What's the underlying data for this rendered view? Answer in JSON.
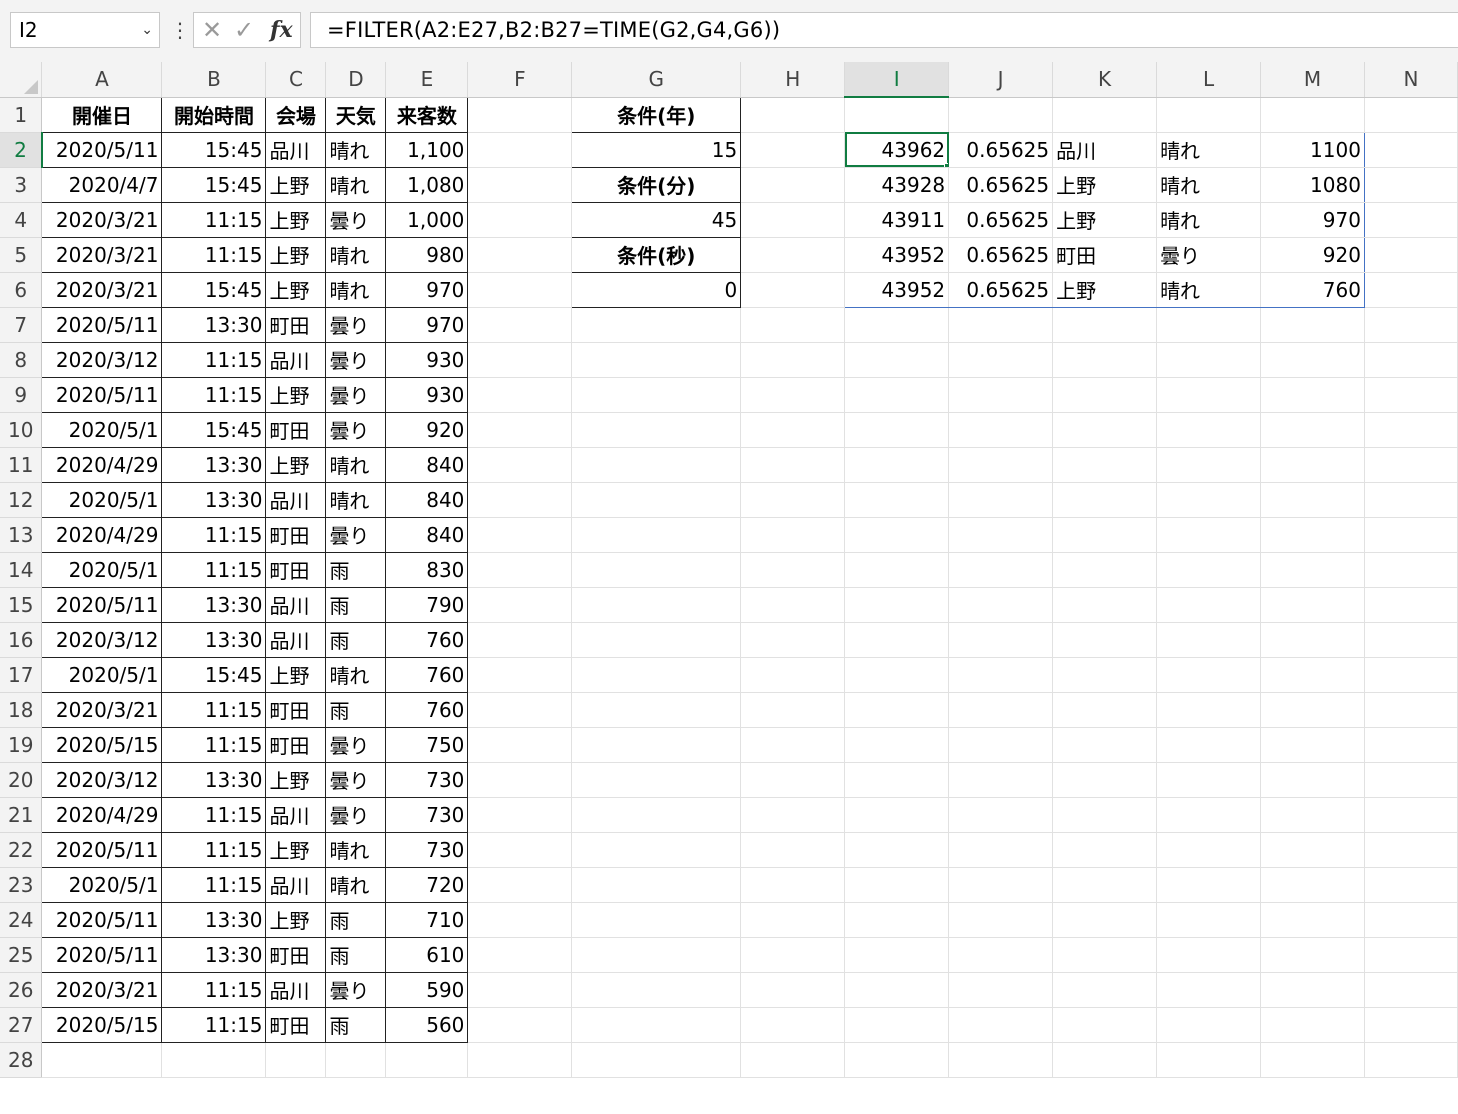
{
  "formula_bar": {
    "name_box": "I2",
    "name_box_icon": "chevron-down-icon",
    "cancel_icon": "✕",
    "enter_icon": "✓",
    "fx_label": "fx",
    "formula": "=FILTER(A2:E27,B2:B27=TIME(G2,G4,G6))"
  },
  "columns": [
    "A",
    "B",
    "C",
    "D",
    "E",
    "F",
    "G",
    "H",
    "I",
    "J",
    "K",
    "L",
    "M",
    "N"
  ],
  "selected_column": "I",
  "selected_row": "2",
  "row_numbers": [
    "1",
    "2",
    "3",
    "4",
    "5",
    "6",
    "7",
    "8",
    "9",
    "10",
    "11",
    "12",
    "13",
    "14",
    "15",
    "16",
    "17",
    "18",
    "19",
    "20",
    "21",
    "22",
    "23",
    "24",
    "25",
    "26",
    "27",
    "28"
  ],
  "headers": [
    "開催日",
    "開始時間",
    "会場",
    "天気",
    "来客数"
  ],
  "table_rows": [
    [
      "2020/5/11",
      "15:45",
      "品川",
      "晴れ",
      "1,100"
    ],
    [
      "2020/4/7",
      "15:45",
      "上野",
      "晴れ",
      "1,080"
    ],
    [
      "2020/3/21",
      "11:15",
      "上野",
      "曇り",
      "1,000"
    ],
    [
      "2020/3/21",
      "11:15",
      "上野",
      "晴れ",
      "980"
    ],
    [
      "2020/3/21",
      "15:45",
      "上野",
      "晴れ",
      "970"
    ],
    [
      "2020/5/11",
      "13:30",
      "町田",
      "曇り",
      "970"
    ],
    [
      "2020/3/12",
      "11:15",
      "品川",
      "曇り",
      "930"
    ],
    [
      "2020/5/11",
      "11:15",
      "上野",
      "曇り",
      "930"
    ],
    [
      "2020/5/1",
      "15:45",
      "町田",
      "曇り",
      "920"
    ],
    [
      "2020/4/29",
      "13:30",
      "上野",
      "晴れ",
      "840"
    ],
    [
      "2020/5/1",
      "13:30",
      "品川",
      "晴れ",
      "840"
    ],
    [
      "2020/4/29",
      "11:15",
      "町田",
      "曇り",
      "840"
    ],
    [
      "2020/5/1",
      "11:15",
      "町田",
      "雨",
      "830"
    ],
    [
      "2020/5/11",
      "13:30",
      "品川",
      "雨",
      "790"
    ],
    [
      "2020/3/12",
      "13:30",
      "品川",
      "雨",
      "760"
    ],
    [
      "2020/5/1",
      "15:45",
      "上野",
      "晴れ",
      "760"
    ],
    [
      "2020/3/21",
      "11:15",
      "町田",
      "雨",
      "760"
    ],
    [
      "2020/5/15",
      "11:15",
      "町田",
      "曇り",
      "750"
    ],
    [
      "2020/3/12",
      "13:30",
      "上野",
      "曇り",
      "730"
    ],
    [
      "2020/4/29",
      "11:15",
      "品川",
      "曇り",
      "730"
    ],
    [
      "2020/5/11",
      "11:15",
      "上野",
      "晴れ",
      "730"
    ],
    [
      "2020/5/1",
      "11:15",
      "品川",
      "晴れ",
      "720"
    ],
    [
      "2020/5/11",
      "13:30",
      "上野",
      "雨",
      "710"
    ],
    [
      "2020/5/11",
      "13:30",
      "町田",
      "雨",
      "610"
    ],
    [
      "2020/3/21",
      "11:15",
      "品川",
      "曇り",
      "590"
    ],
    [
      "2020/5/15",
      "11:15",
      "町田",
      "雨",
      "560"
    ]
  ],
  "conditions": [
    {
      "label": "条件(年)",
      "value": "15"
    },
    {
      "label": "条件(分)",
      "value": "45"
    },
    {
      "label": "条件(秒)",
      "value": "0"
    }
  ],
  "filter_result": [
    [
      "43962",
      "0.65625",
      "品川",
      "晴れ",
      "1100"
    ],
    [
      "43928",
      "0.65625",
      "上野",
      "晴れ",
      "1080"
    ],
    [
      "43911",
      "0.65625",
      "上野",
      "晴れ",
      "970"
    ],
    [
      "43952",
      "0.65625",
      "町田",
      "曇り",
      "920"
    ],
    [
      "43952",
      "0.65625",
      "上野",
      "晴れ",
      "760"
    ]
  ],
  "colors": {
    "selection": "#107c41",
    "spill_border": "#4472c4",
    "gridline": "#e1e1e1",
    "header_bg": "#f3f3f3"
  }
}
